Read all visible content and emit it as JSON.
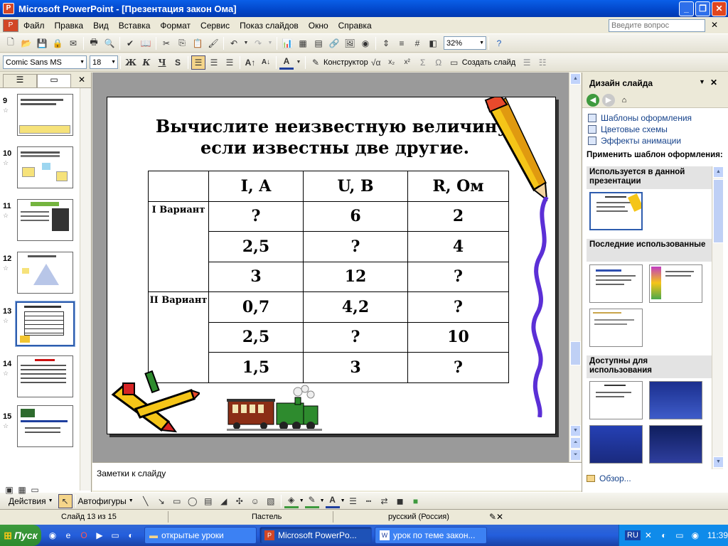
{
  "window": {
    "title": "Microsoft PowerPoint - [Презентация закон Ома]"
  },
  "menu": {
    "items": [
      "Файл",
      "Правка",
      "Вид",
      "Вставка",
      "Формат",
      "Сервис",
      "Показ слайдов",
      "Окно",
      "Справка"
    ],
    "help_placeholder": "Введите вопрос"
  },
  "toolbar": {
    "zoom": "32%"
  },
  "format_bar": {
    "font": "Comic Sans MS",
    "size": "18",
    "bold": "Ж",
    "italic": "К",
    "underline": "Ч",
    "shadow": "S",
    "designer": "Конструктор",
    "create_slide": "Создать слайд"
  },
  "thumbnails": [
    {
      "num": "9"
    },
    {
      "num": "10"
    },
    {
      "num": "11"
    },
    {
      "num": "12"
    },
    {
      "num": "13"
    },
    {
      "num": "14"
    },
    {
      "num": "15"
    }
  ],
  "slide": {
    "title_line1": "Вычислите неизвестную величину,",
    "title_line2": "если известны две другие.",
    "headers": [
      "",
      "I, A",
      "U, B",
      "R, Ом"
    ],
    "variant1": "I Вариант",
    "variant2": "II Вариант",
    "rows": [
      [
        "?",
        "6",
        "2"
      ],
      [
        "2,5",
        "?",
        "4"
      ],
      [
        "3",
        "12",
        "?"
      ],
      [
        "0,7",
        "4,2",
        "?"
      ],
      [
        "2,5",
        "?",
        "10"
      ],
      [
        "1,5",
        "3",
        "?"
      ]
    ]
  },
  "notes": {
    "placeholder": "Заметки к слайду"
  },
  "task_pane": {
    "title": "Дизайн слайда",
    "links": [
      "Шаблоны оформления",
      "Цветовые схемы",
      "Эффекты анимации"
    ],
    "apply_label": "Применить шаблон оформления:",
    "sections": [
      "Используется в данной презентации",
      "Последние использованные",
      "Доступны для использования"
    ],
    "browse": "Обзор..."
  },
  "draw_bar": {
    "actions": "Действия",
    "autoshapes": "Автофигуры"
  },
  "status": {
    "slide": "Слайд 13 из 15",
    "design": "Пастель",
    "language": "русский (Россия)"
  },
  "taskbar": {
    "start": "Пуск",
    "tasks": [
      "открытые уроки",
      "Microsoft PowerPo...",
      "урок по теме закон..."
    ],
    "lang": "RU",
    "clock": "11:39"
  }
}
